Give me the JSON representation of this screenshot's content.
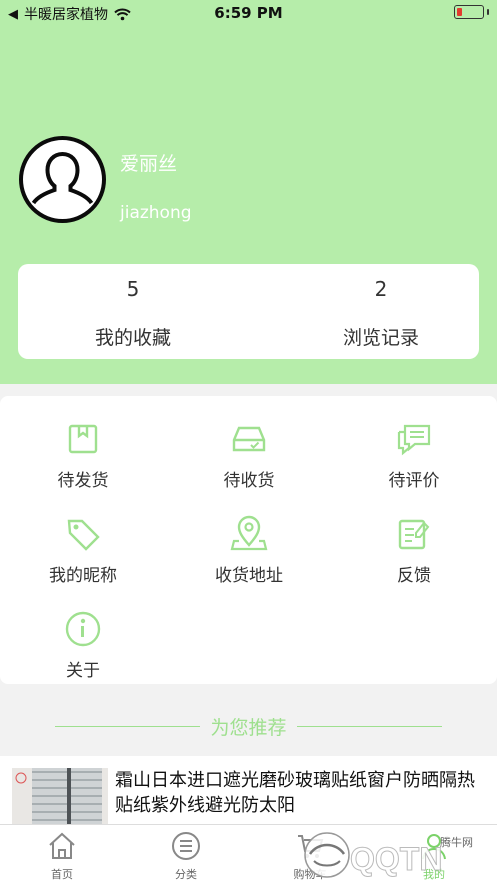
{
  "status_bar": {
    "back_label": "半暖居家植物",
    "time": "6:59 PM"
  },
  "profile": {
    "name": "爱丽丝",
    "id": "jiazhong"
  },
  "stats": [
    {
      "count": "5",
      "label": "我的收藏"
    },
    {
      "count": "2",
      "label": "浏览记录"
    }
  ],
  "menu": [
    {
      "label": "待发货",
      "icon": "box-icon"
    },
    {
      "label": "待收货",
      "icon": "inbox-icon"
    },
    {
      "label": "待评价",
      "icon": "comment-icon"
    },
    {
      "label": "我的昵称",
      "icon": "tag-icon"
    },
    {
      "label": "收货地址",
      "icon": "location-icon"
    },
    {
      "label": "反馈",
      "icon": "feedback-icon"
    },
    {
      "label": "关于",
      "icon": "info-icon"
    }
  ],
  "recommend": {
    "title": "为您推荐"
  },
  "products": [
    {
      "title": "霜山日本进口遮光磨砂玻璃贴纸窗户防晒隔热贴纸紫外线避光防太阳"
    }
  ],
  "tabs": [
    {
      "label": "首页",
      "icon": "home-icon"
    },
    {
      "label": "分类",
      "icon": "list-icon"
    },
    {
      "label": "购物车",
      "icon": "cart-icon"
    },
    {
      "label": "我的",
      "icon": "user-icon"
    }
  ],
  "watermark": {
    "text": "QQTN",
    "sub": "腾牛网"
  },
  "colors": {
    "header_bg": "#b6edaa",
    "accent": "#7bd269",
    "line": "#9fe08f"
  }
}
